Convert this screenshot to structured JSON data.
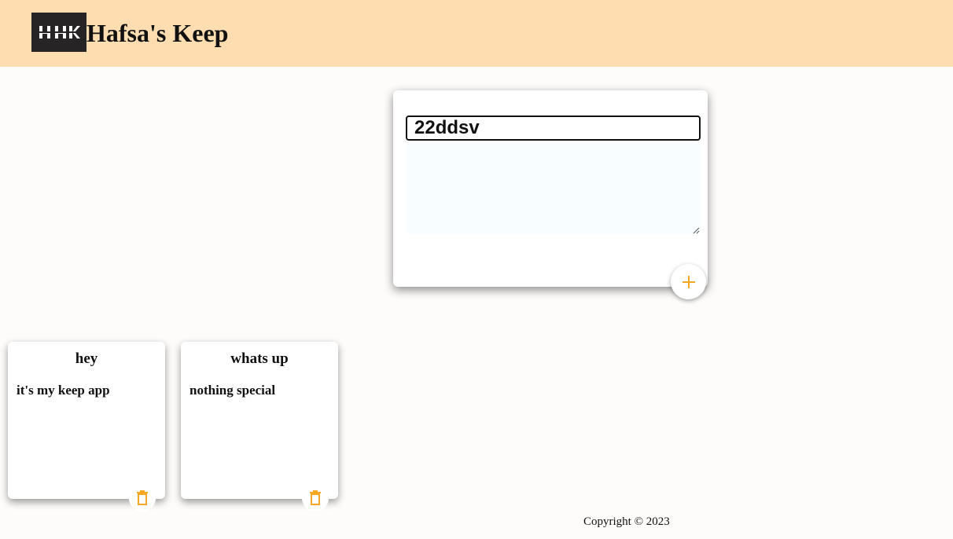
{
  "header": {
    "title": "Hafsa's Keep",
    "logo_text": "HK",
    "logo_icon": "hk-logo-icon",
    "background": "#fedeb0"
  },
  "composer": {
    "title_value": "22ddsv",
    "content_value": "",
    "add_icon": "plus-icon",
    "accent": "#f5a623"
  },
  "notes": [
    {
      "title": "hey",
      "content": "it's my keep app",
      "delete_icon": "trash-icon"
    },
    {
      "title": "whats up",
      "content": "nothing special",
      "delete_icon": "trash-icon"
    }
  ],
  "footer": {
    "copyright": "Copyright © 2023"
  }
}
